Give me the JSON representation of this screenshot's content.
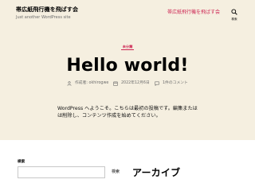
{
  "header": {
    "site_title": "帯広紙飛行機を飛ばす会",
    "site_description": "Just another WordPress site",
    "nav_link": "帯広紙飛行機を飛ばす会",
    "search_label": "検索"
  },
  "post": {
    "category": "未分類",
    "title": "Hello world!",
    "meta": {
      "author": "作成者: okhirogwe",
      "date": "2022年12月6日",
      "comments": "1件のコメント"
    },
    "content_lines": [
      "WordPress へようこそ。こちらは最初の投稿です。編集または",
      "は削除し、コンテンツ作成を始めてください。"
    ]
  },
  "sidebar": {
    "search_widget_label": "検索",
    "search_value": "",
    "search_button": "検索",
    "archive_heading": "アーカイブ"
  },
  "colors": {
    "accent": "#cd2653",
    "background": "#f5efe0",
    "muted": "#6d6d6d"
  },
  "icons": {
    "search": "search-icon",
    "author": "person-icon",
    "date": "calendar-icon",
    "comments": "comment-icon"
  }
}
